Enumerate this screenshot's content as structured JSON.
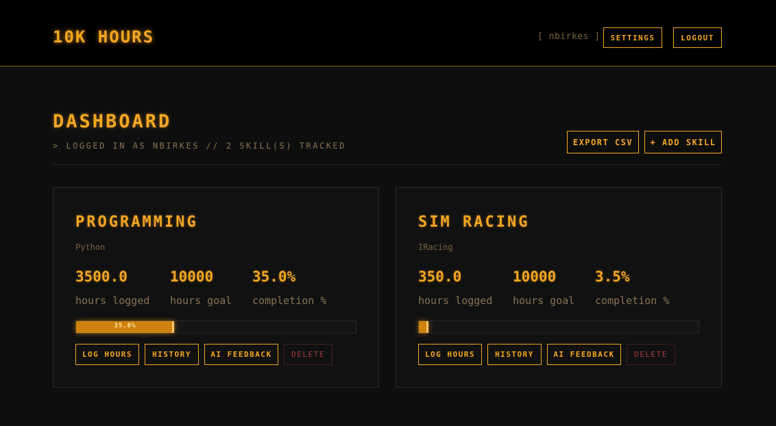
{
  "header": {
    "logo": "10K HOURS",
    "user_tag": "[ nbirkes ]",
    "settings_label": "SETTINGS",
    "logout_label": "LOGOUT"
  },
  "dashboard": {
    "title": "DASHBOARD",
    "subtitle": "> LOGGED IN AS NBIRKES // 2 SKILL(S) TRACKED",
    "export_label": "EXPORT CSV",
    "add_label": "+ ADD SKILL"
  },
  "skills": [
    {
      "name": "PROGRAMMING",
      "sub": "Python",
      "hours_logged": "3500.0",
      "hours_goal": "10000",
      "completion": "35.0%",
      "progress_fraction": 0.35,
      "progress_label": "35.0%"
    },
    {
      "name": "SIM RACING",
      "sub": "IRacing",
      "hours_logged": "350.0",
      "hours_goal": "10000",
      "completion": "3.5%",
      "progress_fraction": 0.035,
      "progress_label": ""
    }
  ],
  "labels": {
    "hours_logged": "hours logged",
    "hours_goal": "hours goal",
    "completion": "completion %",
    "log_hours": "LOG HOURS",
    "history": "HISTORY",
    "ai_feedback": "AI FEEDBACK",
    "delete": "DELETE"
  },
  "colors": {
    "accent": "#f5a623",
    "background": "#0e0e0e",
    "danger": "#a33a3a"
  }
}
